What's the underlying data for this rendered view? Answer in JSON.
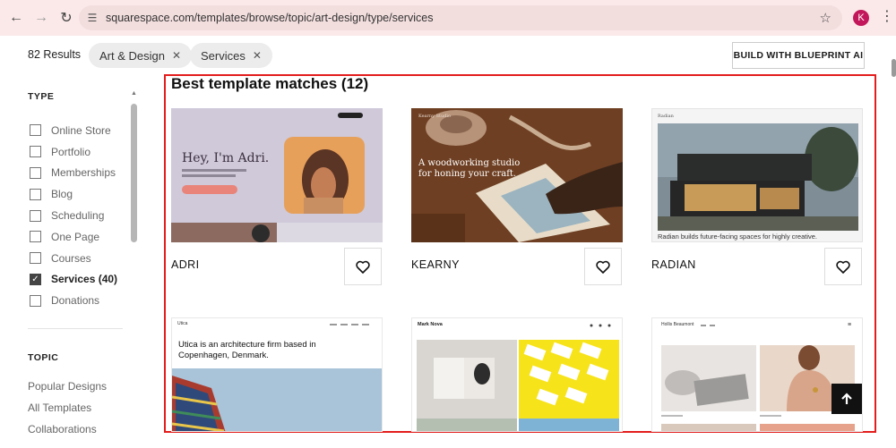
{
  "browser": {
    "url": "squarespace.com/templates/browse/topic/art-design/type/services",
    "avatar_letter": "K"
  },
  "filters": {
    "results": "82 Results",
    "chips": [
      "Art & Design",
      "Services"
    ],
    "build_button": "BUILD WITH BLUEPRINT AI"
  },
  "sidebar": {
    "type_heading": "TYPE",
    "types": [
      {
        "label": "Online Store",
        "checked": false
      },
      {
        "label": "Portfolio",
        "checked": false
      },
      {
        "label": "Memberships",
        "checked": false
      },
      {
        "label": "Blog",
        "checked": false
      },
      {
        "label": "Scheduling",
        "checked": false
      },
      {
        "label": "One Page",
        "checked": false
      },
      {
        "label": "Courses",
        "checked": false
      },
      {
        "label": "Services (40)",
        "checked": true
      },
      {
        "label": "Donations",
        "checked": false
      }
    ],
    "topic_heading": "TOPIC",
    "topics": [
      "Popular Designs",
      "All Templates",
      "Collaborations"
    ]
  },
  "main": {
    "title": "Best template matches (12)",
    "templates": [
      {
        "name": "ADRI",
        "preview_text": "Hey, I'm Adri."
      },
      {
        "name": "KEARNY",
        "brand": "Kearny Studio",
        "preview_text": "A woodworking studio for honing your craft."
      },
      {
        "name": "RADIAN",
        "brand": "Radian",
        "preview_text": "Radian builds future-facing spaces for highly creative."
      },
      {
        "name": "",
        "brand": "Utica",
        "preview_text": "Utica is an architecture firm based in Copenhagen, Denmark."
      },
      {
        "name": "",
        "brand": "Mark Nova",
        "preview_text": ""
      },
      {
        "name": "",
        "brand": "Hollis Beaumont",
        "preview_text": ""
      }
    ]
  },
  "colors": {
    "highlight": "#e31c1c",
    "accent": "#f7d21a"
  }
}
